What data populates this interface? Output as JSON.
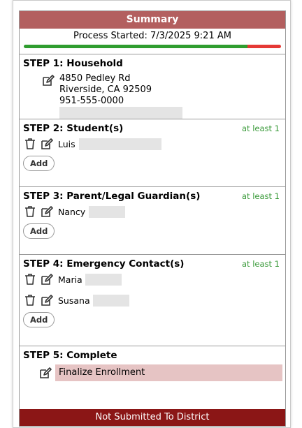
{
  "summary_title": "Summary",
  "process_started": "Process Started: 7/3/2025 9:21 AM",
  "progress_fraction": 0.87,
  "colors": {
    "header": "#b35f5f",
    "progress_done": "#2f9d2f",
    "progress_rest": "#e53935",
    "required": "#3a9a3a",
    "footer": "#8b1616",
    "finalize_bg": "#e6c4c4"
  },
  "step1": {
    "title": "STEP 1: Household",
    "address_line1": "4850 Pedley Rd",
    "address_line2": "Riverside, CA 92509",
    "phone": "951-555-0000"
  },
  "step2": {
    "title": "STEP 2: Student(s)",
    "requirement": "at least 1",
    "items": [
      {
        "name": "Luis"
      }
    ],
    "add_label": "Add"
  },
  "step3": {
    "title": "STEP 3: Parent/Legal Guardian(s)",
    "requirement": "at least 1",
    "items": [
      {
        "name": "Nancy"
      }
    ],
    "add_label": "Add"
  },
  "step4": {
    "title": "STEP 4: Emergency Contact(s)",
    "requirement": "at least 1",
    "items": [
      {
        "name": "Maria"
      },
      {
        "name": "Susana"
      }
    ],
    "add_label": "Add"
  },
  "step5": {
    "title": "STEP 5: Complete",
    "finalize_label": "Finalize Enrollment"
  },
  "footer_status": "Not Submitted To District"
}
